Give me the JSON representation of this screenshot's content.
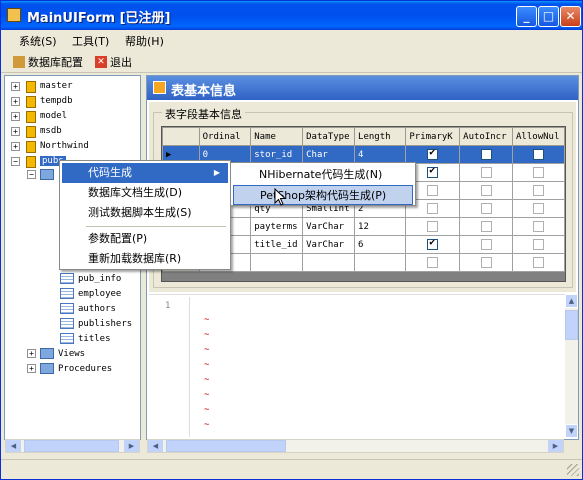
{
  "window": {
    "title": "MainUIForm [已注册]"
  },
  "menubar": [
    "系统(S)",
    "工具(T)",
    "帮助(H)"
  ],
  "toolbar": {
    "db_config": "数据库配置",
    "exit": "退出"
  },
  "tree": {
    "databases": [
      "master",
      "tempdb",
      "model",
      "msdb",
      "Northwind",
      "pubs"
    ],
    "tables": [
      "pub_info",
      "employee",
      "authors",
      "publishers",
      "titles"
    ],
    "views": "Views",
    "procedures": "Procedures"
  },
  "panel": {
    "title": "表基本信息",
    "group_title": "表字段基本信息"
  },
  "grid": {
    "columns": [
      "Ordinal",
      "Name",
      "DataType",
      "Length",
      "PrimaryK",
      "AutoIncr",
      "AllowNul"
    ],
    "rows": [
      {
        "ordinal": "0",
        "name": "stor_id",
        "type": "Char",
        "length": "4",
        "pk": true
      },
      {
        "ordinal": "",
        "name": "",
        "type": "",
        "length": "",
        "pk": true
      },
      {
        "ordinal": "",
        "name": "",
        "type": "",
        "length": "",
        "pk": false
      },
      {
        "ordinal": "",
        "name": "qty",
        "type": "SmallInt",
        "length": "2",
        "pk": false
      },
      {
        "ordinal": "",
        "name": "payterms",
        "type": "VarChar",
        "length": "12",
        "pk": false
      },
      {
        "ordinal": "",
        "name": "title_id",
        "type": "VarChar",
        "length": "6",
        "pk": true
      },
      {
        "ordinal": "",
        "name": "",
        "type": "",
        "length": "",
        "pk": false
      }
    ]
  },
  "editor": {
    "line_number": "1",
    "tilde": "~"
  },
  "context_menu": {
    "items": [
      "代码生成",
      "数据库文档生成(D)",
      "测试数据脚本生成(S)",
      "参数配置(P)",
      "重新加载数据库(R)"
    ],
    "submenu": [
      "NHibernate代码生成(N)",
      "PetShop架构代码生成(P)"
    ]
  },
  "colors": {
    "accent": "#316ac5",
    "titlebar": "#0053ee",
    "panel_header": "#2f62c5"
  }
}
